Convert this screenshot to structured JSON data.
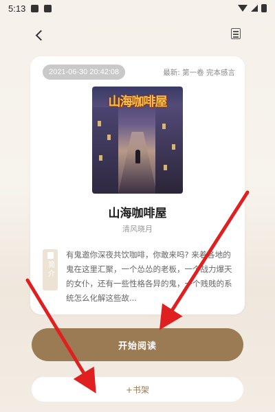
{
  "status_bar": {
    "time": "5:13",
    "icons": [
      "image-notification-icon",
      "a-notification-icon",
      "wifi-icon",
      "signal-icon",
      "battery-icon"
    ]
  },
  "nav": {
    "back_icon": "chevron-left-icon",
    "menu_icon": "document-list-icon"
  },
  "card": {
    "timestamp": "2021-06-30 20:42:08",
    "latest_chapter": "最新: 第一卷 完本感言",
    "cover_title": "山海咖啡屋",
    "book_title": "山海咖啡屋",
    "author": "清风晓月",
    "synopsis_tag": "简介",
    "synopsis": "有鬼邀你深夜共饮咖啡，你敢来吗? 来着各地的鬼在这里汇聚，一个怂怂的老板，一个战力爆天的女仆，还有一些性格各异的鬼，一个贱贱的系统怎么化解这些故..."
  },
  "actions": {
    "start_reading": "开始阅读",
    "add_bookshelf": "+书架"
  },
  "colors": {
    "accent": "#9b7b54",
    "annotation_arrow": "#e02020"
  }
}
